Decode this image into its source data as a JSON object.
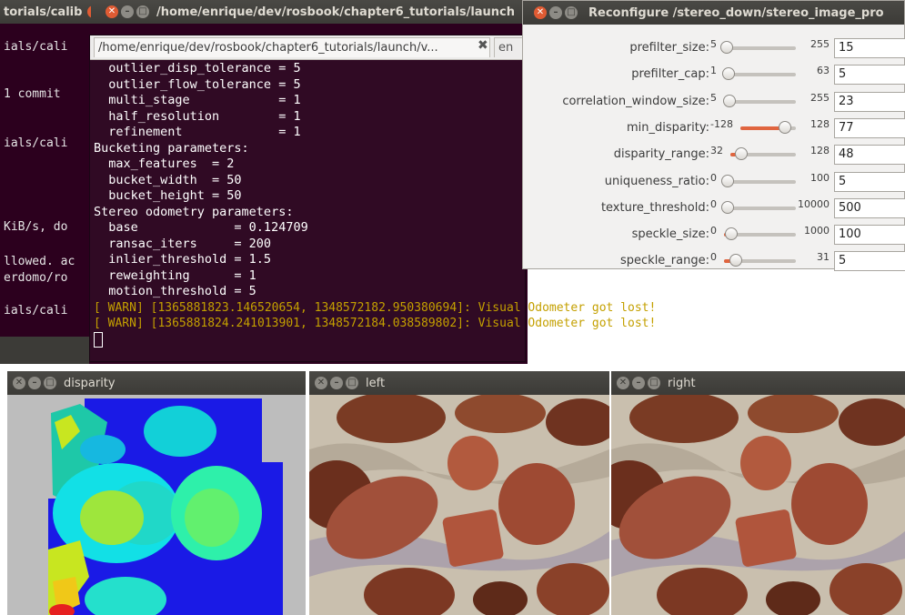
{
  "back_terminal": {
    "title": "torials/calib",
    "lines": [
      "ials/cali",
      "1 commit",
      "ials/cali",
      "KiB/s, do",
      "llowed. ac",
      "erdomo/ro",
      "ials/cali"
    ]
  },
  "front_terminal": {
    "title": "/home/enrique/dev/rosbook/chapter6_tutorials/launch",
    "tab_label": "/home/enrique/dev/rosbook/chapter6_tutorials/launch/v...",
    "tab2_label": "en",
    "lines": [
      "  outlier_disp_tolerance = 5",
      "  outlier_flow_tolerance = 5",
      "  multi_stage            = 1",
      "  half_resolution        = 1",
      "  refinement             = 1",
      "Bucketing parameters:",
      "  max_features  = 2",
      "  bucket_width  = 50",
      "  bucket_height = 50",
      "Stereo odometry parameters:",
      "  base             = 0.124709",
      "  ransac_iters     = 200",
      "  inlier_threshold = 1.5",
      "  reweighting      = 1",
      "  motion_threshold = 5"
    ],
    "warnings": [
      "[ WARN] [1365881823.146520654, 1348572182.950380694]: Visual Odometer got lost!",
      "[ WARN] [1365881824.241013901, 1348572184.038589802]: Visual Odometer got lost!"
    ]
  },
  "reconfigure": {
    "title": "Reconfigure /stereo_down/stereo_image_pro",
    "params": [
      {
        "name": "prefilter_size:",
        "min": "5",
        "max": "255",
        "value": "15",
        "level": 0.04
      },
      {
        "name": "prefilter_cap:",
        "min": "1",
        "max": "63",
        "value": "5",
        "level": 0.06
      },
      {
        "name": "correlation_window_size:",
        "min": "5",
        "max": "255",
        "value": "23",
        "level": 0.07
      },
      {
        "name": "min_disparity:",
        "min": "-128",
        "max": "128",
        "value": "77",
        "level": 0.8
      },
      {
        "name": "disparity_range:",
        "min": "32",
        "max": "128",
        "value": "48",
        "level": 0.17
      },
      {
        "name": "uniqueness_ratio:",
        "min": "0",
        "max": "100",
        "value": "5",
        "level": 0.05
      },
      {
        "name": "texture_threshold:",
        "min": "0",
        "max": "10000",
        "value": "500",
        "level": 0.05
      },
      {
        "name": "speckle_size:",
        "min": "0",
        "max": "1000",
        "value": "100",
        "level": 0.1
      },
      {
        "name": "speckle_range:",
        "min": "0",
        "max": "31",
        "value": "5",
        "level": 0.16
      }
    ]
  },
  "image_windows": {
    "disparity_title": "disparity",
    "left_title": "left",
    "right_title": "right"
  }
}
